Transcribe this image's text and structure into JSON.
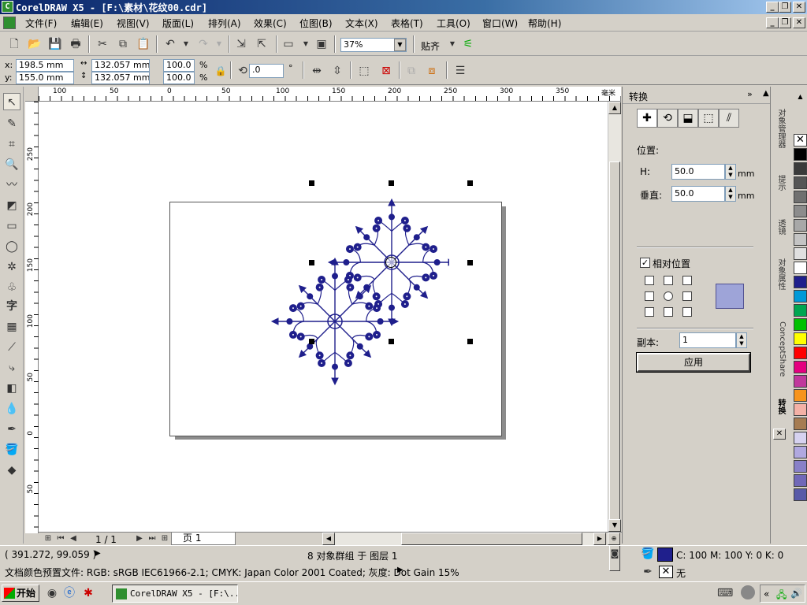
{
  "window": {
    "title": "CorelDRAW X5 - [F:\\素材\\花纹00.cdr]",
    "min": "_",
    "max": "❐",
    "close": "✕"
  },
  "menu": [
    "文件(F)",
    "编辑(E)",
    "视图(V)",
    "版面(L)",
    "排列(A)",
    "效果(C)",
    "位图(B)",
    "文本(X)",
    "表格(T)",
    "工具(O)",
    "窗口(W)",
    "帮助(H)"
  ],
  "toolbar": {
    "zoom": "37%",
    "snap": "贴齐"
  },
  "property_bar": {
    "x_label": "x:",
    "x": "198.5 mm",
    "y_label": "y:",
    "y": "155.0 mm",
    "w": "132.057 mm",
    "h": "132.057 mm",
    "scale_w": "100.0",
    "scale_h": "100.0",
    "pct": "%",
    "rotation": ".0",
    "degree": "°"
  },
  "rulers": {
    "h_ticks": [
      "100",
      "50",
      "0",
      "50",
      "100",
      "150",
      "200",
      "250",
      "300",
      "350"
    ],
    "h_unit": "毫米",
    "v_ticks": [
      "250",
      "200",
      "150",
      "100",
      "50",
      "0",
      "50"
    ]
  },
  "docker": {
    "title": "转换",
    "position_label": "位置:",
    "h_label": "H:",
    "h_value": "50.0",
    "v_label": "垂直:",
    "v_value": "50.0",
    "unit": "mm",
    "relative_label": "相对位置",
    "relative_checked": true,
    "copies_label": "副本:",
    "copies_value": "1",
    "apply": "应用"
  },
  "side_tabs": [
    "对象管理器",
    "提示",
    "透镜",
    "对象属性",
    "ConceptShare",
    "转换"
  ],
  "page_nav": {
    "page_count": "1 / 1",
    "page_tab": "页 1"
  },
  "status": {
    "coords": "( 391.272, 99.059 )",
    "selection": "8 对象群组 于 图层 1",
    "fill_info": "C: 100 M: 100 Y: 0 K: 0",
    "outline": "无",
    "color_profile": "文档颜色预置文件: RGB: sRGB IEC61966-2.1; CMYK: Japan Color 2001 Coated; 灰度: Dot Gain 15%"
  },
  "taskbar": {
    "start": "开始",
    "task": "CorelDRAW X5 - [F:\\..."
  },
  "colors": {
    "ornament": "#1f1f8c",
    "fill_swatch": "#1f1f8c",
    "palette": [
      "#000000",
      "#3a3a3a",
      "#555555",
      "#707070",
      "#8c8c8c",
      "#a8a8a8",
      "#c4c4c4",
      "#e0e0e0",
      "#ffffff",
      "#1f1f8c",
      "#0099d8",
      "#00a651",
      "#00c000",
      "#ffff00",
      "#ff0000",
      "#e4007f",
      "#c0399c",
      "#f7941d",
      "#f4b1a6",
      "#a67c52",
      "#d6d2f0",
      "#b0a8e0",
      "#8880c8",
      "#7068b8",
      "#585aa8"
    ]
  }
}
